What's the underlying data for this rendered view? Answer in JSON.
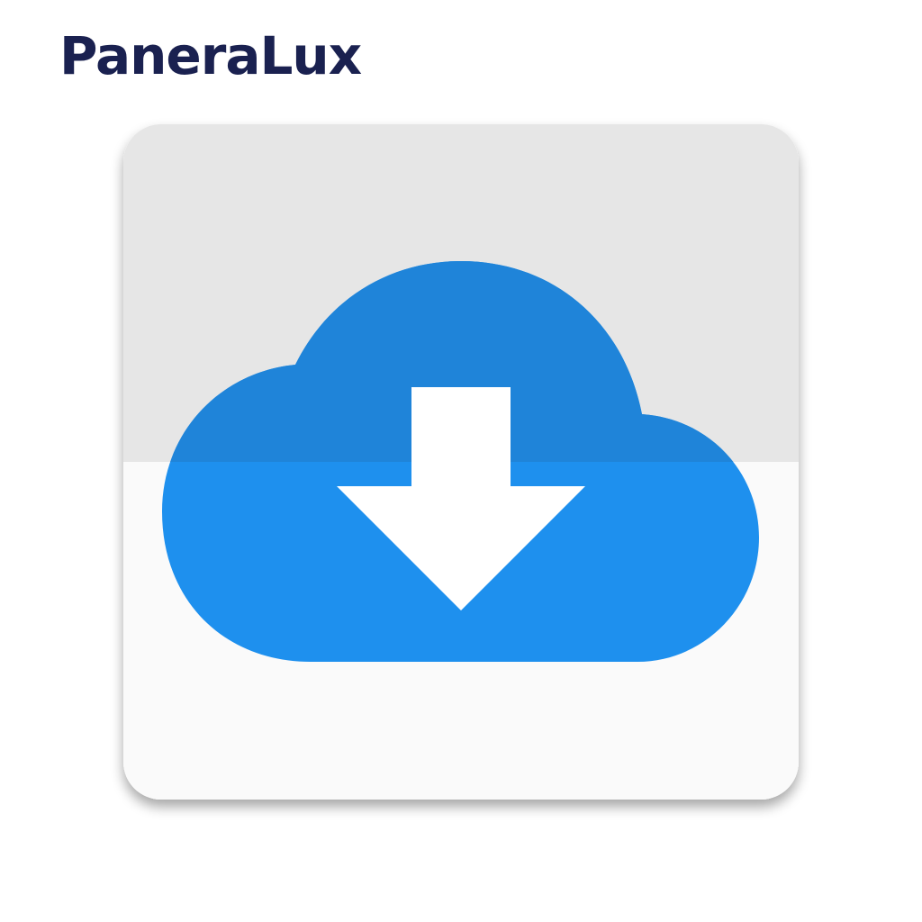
{
  "brand": {
    "name": "PaneraLux",
    "color": "#1a2150"
  },
  "app_icon": {
    "icon": "cloud-download-icon",
    "colors": {
      "tile_top": "#e6e6e6",
      "tile_bottom": "#fafafa",
      "cloud": "#1e90ee",
      "cloud_shade": "#1f84d9",
      "arrow": "#ffffff"
    }
  }
}
